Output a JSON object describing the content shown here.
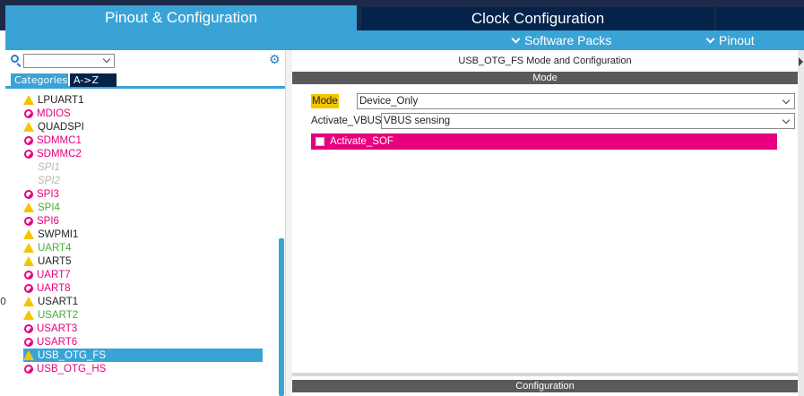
{
  "tabs": {
    "pinout": "Pinout & Configuration",
    "clock": "Clock Configuration"
  },
  "menubar": {
    "software_packs": "Software Packs",
    "pinout": "Pinout"
  },
  "left": {
    "search_value": "",
    "view_tabs": {
      "categories": "Categories",
      "az": "A->Z"
    },
    "edge_text": "0",
    "items": [
      {
        "label": "LPUART1",
        "icon": "warning-icon",
        "style": "black"
      },
      {
        "label": "MDIOS",
        "icon": "disabled-icon",
        "style": "pink"
      },
      {
        "label": "QUADSPI",
        "icon": "warning-icon",
        "style": "black"
      },
      {
        "label": "SDMMC1",
        "icon": "disabled-icon",
        "style": "pink"
      },
      {
        "label": "SDMMC2",
        "icon": "disabled-icon",
        "style": "pink"
      },
      {
        "label": "SPI1",
        "icon": "none",
        "style": "grey"
      },
      {
        "label": "SPI2",
        "icon": "none",
        "style": "grey"
      },
      {
        "label": "SPI3",
        "icon": "disabled-icon",
        "style": "pink"
      },
      {
        "label": "SPI4",
        "icon": "warning-icon",
        "style": "green"
      },
      {
        "label": "SPI6",
        "icon": "disabled-icon",
        "style": "pink"
      },
      {
        "label": "SWPMI1",
        "icon": "warning-icon",
        "style": "black"
      },
      {
        "label": "UART4",
        "icon": "warning-icon",
        "style": "green"
      },
      {
        "label": "UART5",
        "icon": "warning-icon",
        "style": "black"
      },
      {
        "label": "UART7",
        "icon": "disabled-icon",
        "style": "pink"
      },
      {
        "label": "UART8",
        "icon": "disabled-icon",
        "style": "pink"
      },
      {
        "label": "USART1",
        "icon": "warning-icon",
        "style": "black"
      },
      {
        "label": "USART2",
        "icon": "warning-icon",
        "style": "green"
      },
      {
        "label": "USART3",
        "icon": "disabled-icon",
        "style": "pink"
      },
      {
        "label": "USART6",
        "icon": "disabled-icon",
        "style": "pink"
      },
      {
        "label": "USB_OTG_FS",
        "icon": "warning-icon",
        "style": "black",
        "selected": true
      },
      {
        "label": "USB_OTG_HS",
        "icon": "disabled-icon",
        "style": "pink"
      }
    ]
  },
  "right": {
    "title": "USB_OTG_FS Mode and Configuration",
    "mode_header": "Mode",
    "mode_label": "Mode",
    "mode_value": "Device_Only",
    "vbus_label": "Activate_VBUS",
    "vbus_value": "VBUS sensing",
    "sof_label": "Activate_SOF",
    "config_header": "Configuration"
  },
  "colors": {
    "accent": "#3aa3d6",
    "navy": "#03234b",
    "pink": "#e6007e",
    "yellow": "#f5c400",
    "green": "#4aab3b"
  }
}
